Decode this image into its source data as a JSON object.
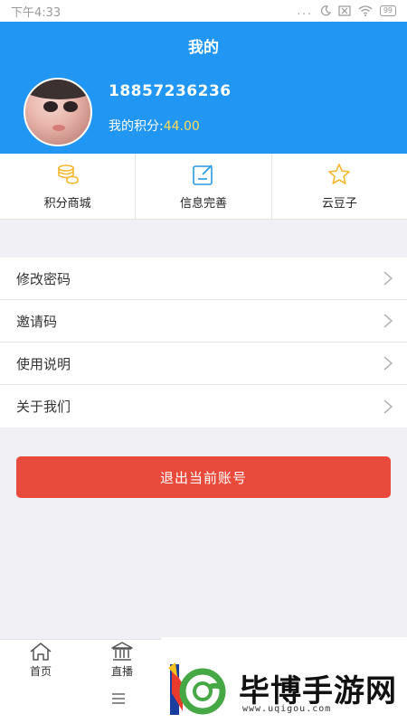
{
  "status_bar": {
    "time": "下午4:33",
    "dots": "...",
    "battery": "99"
  },
  "header": {
    "title": "我的"
  },
  "profile": {
    "phone": "18857236236",
    "points_label": "我的积分:",
    "points_value": "44.00"
  },
  "quick_links": [
    {
      "label": "积分商城",
      "icon": "coins-icon"
    },
    {
      "label": "信息完善",
      "icon": "edit-icon"
    },
    {
      "label": "云豆子",
      "icon": "star-icon"
    }
  ],
  "menu": [
    {
      "label": "修改密码"
    },
    {
      "label": "邀请码"
    },
    {
      "label": "使用说明"
    },
    {
      "label": "关于我们"
    }
  ],
  "logout": {
    "label": "退出当前账号"
  },
  "tabs": [
    {
      "label": "首页",
      "icon": "home-icon"
    },
    {
      "label": "直播",
      "icon": "bank-icon"
    }
  ],
  "watermark": {
    "name": "毕博手游网",
    "url": "www.uqigou.com"
  },
  "colors": {
    "header": "#2196f3",
    "accent_gold": "#f5b82e",
    "logout": "#e84a3b",
    "icon_blue": "#2a9ae0"
  }
}
